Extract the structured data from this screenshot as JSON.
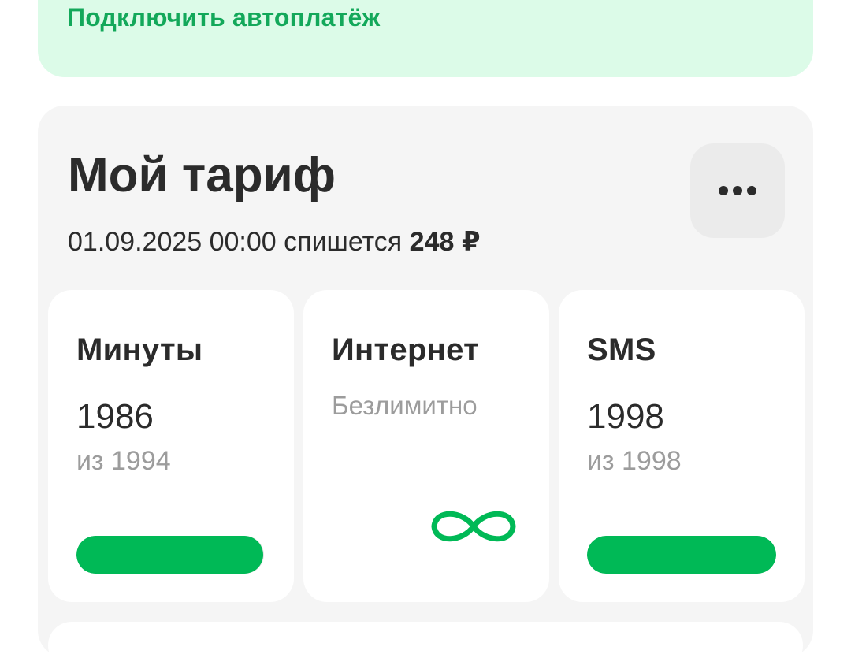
{
  "autopay": {
    "link_label": "Подключить автоплатёж"
  },
  "tariff": {
    "title": "Мой тариф",
    "charge_datetime": "01.09.2025 00:00",
    "charge_text": "спишется",
    "charge_amount": "248 ₽",
    "more_icon": "more-horizontal-icon"
  },
  "resources": {
    "minutes": {
      "title": "Минуты",
      "remaining": "1986",
      "total_label": "из 1994",
      "remaining_fraction": 0.996
    },
    "internet": {
      "title": "Интернет",
      "status": "Безлимитно",
      "icon": "infinity-icon"
    },
    "sms": {
      "title": "SMS",
      "remaining": "1998",
      "total_label": "из 1998",
      "remaining_fraction": 1.0
    }
  },
  "colors": {
    "accent": "#00b956",
    "link": "#13a85a",
    "banner_bg": "#dcfbe8",
    "card_bg": "#f5f5f5",
    "secondary_text": "#9c9c9c"
  }
}
